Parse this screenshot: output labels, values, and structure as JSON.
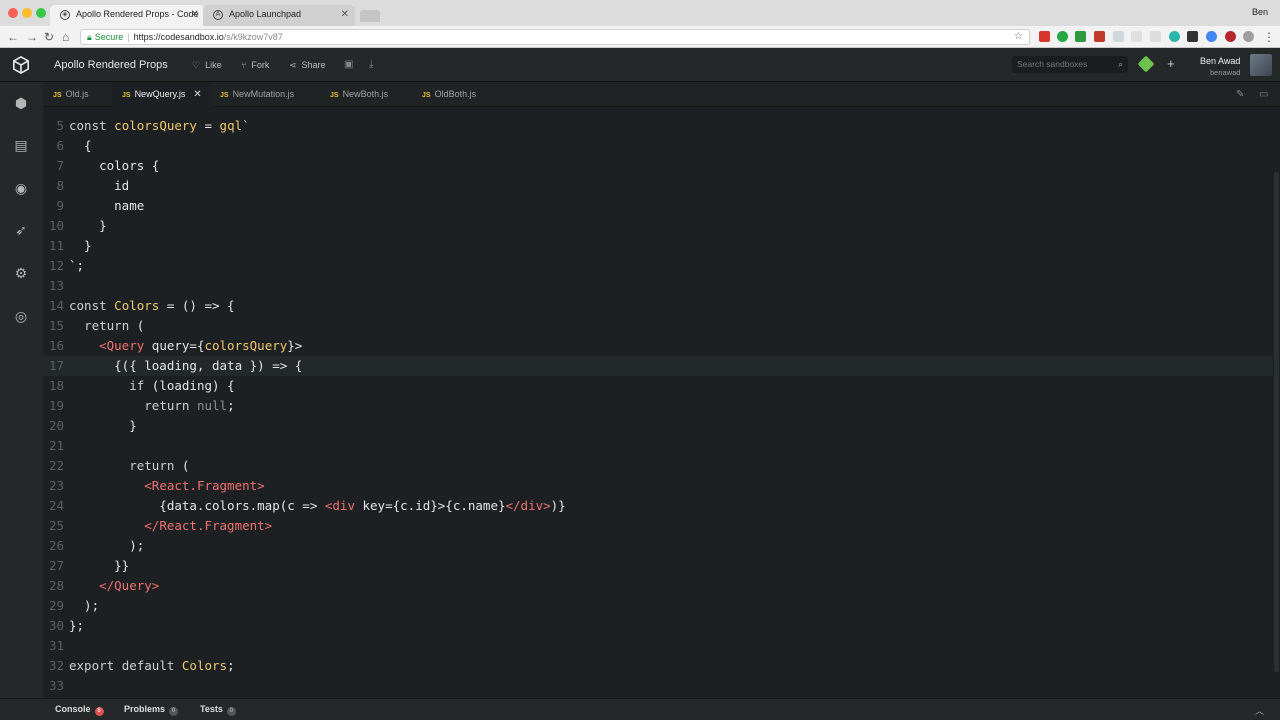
{
  "browser": {
    "tabs": [
      {
        "title": "Apollo Rendered Props - Code",
        "active": true
      },
      {
        "title": "Apollo Launchpad",
        "active": false
      }
    ],
    "profile": "Ben",
    "address": {
      "secure_label": "Secure",
      "url_host": "https://codesandbox.io",
      "url_path": "/s/k9kzow7v87"
    }
  },
  "app": {
    "title": "Apollo Rendered Props",
    "actions": {
      "like": "Like",
      "fork": "Fork",
      "share": "Share"
    },
    "search_placeholder": "Search sandboxes",
    "user": {
      "name": "Ben Awad",
      "handle": "benawad"
    }
  },
  "editor_tabs": [
    {
      "label": "Old.js",
      "active": false
    },
    {
      "label": "NewQuery.js",
      "active": true
    },
    {
      "label": "NewMutation.js",
      "active": false
    },
    {
      "label": "NewBoth.js",
      "active": false
    },
    {
      "label": "OldBoth.js",
      "active": false
    }
  ],
  "code": {
    "current_line": 17,
    "lines": [
      {
        "n": "5",
        "text": "const colorsQuery = gql`"
      },
      {
        "n": "6",
        "text": "  {"
      },
      {
        "n": "7",
        "text": "    colors {"
      },
      {
        "n": "8",
        "text": "      id"
      },
      {
        "n": "9",
        "text": "      name"
      },
      {
        "n": "10",
        "text": "    }"
      },
      {
        "n": "11",
        "text": "  }"
      },
      {
        "n": "12",
        "text": "`;"
      },
      {
        "n": "13",
        "text": ""
      },
      {
        "n": "14",
        "text": "const Colors = () => {"
      },
      {
        "n": "15",
        "text": "  return ("
      },
      {
        "n": "16",
        "text": "    <Query query={colorsQuery}>"
      },
      {
        "n": "17",
        "text": "      {({ loading, data }) => {"
      },
      {
        "n": "18",
        "text": "        if (loading) {"
      },
      {
        "n": "19",
        "text": "          return null;"
      },
      {
        "n": "20",
        "text": "        }"
      },
      {
        "n": "21",
        "text": ""
      },
      {
        "n": "22",
        "text": "        return ("
      },
      {
        "n": "23",
        "text": "          <React.Fragment>"
      },
      {
        "n": "24",
        "text": "            {data.colors.map(c => <div key={c.id}>{c.name}</div>)}"
      },
      {
        "n": "25",
        "text": "          </React.Fragment>"
      },
      {
        "n": "26",
        "text": "        );"
      },
      {
        "n": "27",
        "text": "      }}"
      },
      {
        "n": "28",
        "text": "    </Query>"
      },
      {
        "n": "29",
        "text": "  );"
      },
      {
        "n": "30",
        "text": "};"
      },
      {
        "n": "31",
        "text": ""
      },
      {
        "n": "32",
        "text": "export default Colors;"
      },
      {
        "n": "33",
        "text": ""
      }
    ]
  },
  "bottom_bar": {
    "console": {
      "label": "Console",
      "count": "8"
    },
    "problems": {
      "label": "Problems",
      "count": "0"
    },
    "tests": {
      "label": "Tests",
      "count": "0"
    }
  }
}
